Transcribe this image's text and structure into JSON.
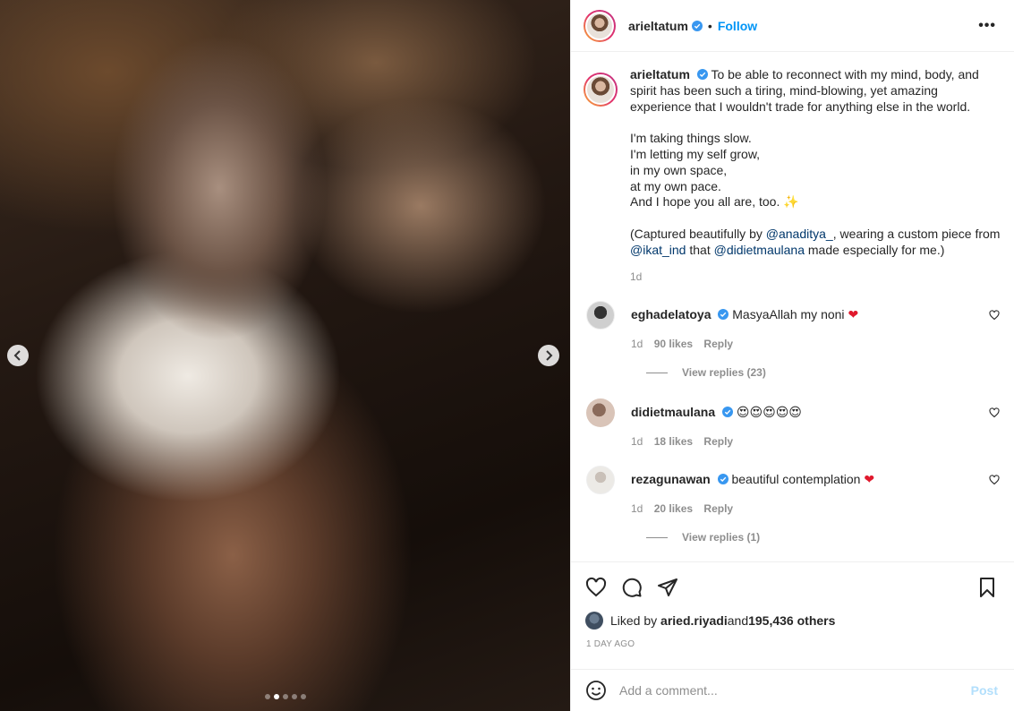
{
  "post": {
    "username": "arieltatum",
    "follow_label": "Follow",
    "separator": "•",
    "more_label": "•••",
    "media_dots": 5,
    "active_dot": 1
  },
  "caption": {
    "username": "arieltatum",
    "line1": "To be able to reconnect with my mind, body, and spirit has been such a tiring, mind-blowing, yet amazing experience that I wouldn't trade for anything else in the world.",
    "poem": [
      "I'm taking things slow.",
      "I'm letting my self grow,",
      "in my own space,",
      "at my own pace.",
      "And I hope you all are, too. ✨"
    ],
    "credit_prefix": "(Captured beautifully by ",
    "credit_mention1": "@anaditya_",
    "credit_mid": ", wearing a custom piece from ",
    "credit_mention2": "@ikat_ind",
    "credit_mid2": " that ",
    "credit_mention3": "@didietmaulana",
    "credit_suffix": " made especially for me.)",
    "time": "1d"
  },
  "comments": [
    {
      "username": "eghadelatoya",
      "text": "MasyaAllah my noni",
      "emoji": "❤",
      "time": "1d",
      "likes": "90 likes",
      "reply": "Reply",
      "view_replies": "View replies (23)"
    },
    {
      "username": "didietmaulana",
      "text": "",
      "emoji": "😍😍😍😍😍",
      "time": "1d",
      "likes": "18 likes",
      "reply": "Reply",
      "view_replies": ""
    },
    {
      "username": "rezagunawan",
      "text": "beautiful contemplation",
      "emoji": "❤",
      "time": "1d",
      "likes": "20 likes",
      "reply": "Reply",
      "view_replies": "View replies (1)"
    }
  ],
  "likes": {
    "prefix": "Liked by ",
    "user": "aried.riyadi",
    "mid": " and ",
    "others": "195,436 others"
  },
  "date": "1 DAY AGO",
  "add_comment": {
    "placeholder": "Add a comment...",
    "post_label": "Post"
  },
  "colors": {
    "link_blue": "#0095f6",
    "mention": "#00376b",
    "muted": "#8e8e8e",
    "heart_red": "#e0192d"
  }
}
